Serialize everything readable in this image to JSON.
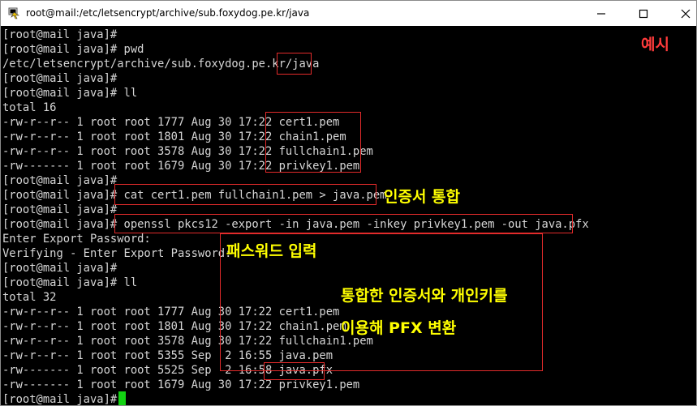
{
  "window": {
    "title": "root@mail:/etc/letsencrypt/archive/sub.foxydog.pe.kr/java",
    "icons": {
      "app": "putty-icon",
      "minimize": "minimize-icon",
      "maximize": "maximize-icon",
      "close": "close-icon"
    }
  },
  "terminal": {
    "lines": [
      "[root@mail java]#",
      "[root@mail java]# pwd",
      "/etc/letsencrypt/archive/sub.foxydog.pe.kr/java",
      "[root@mail java]#",
      "[root@mail java]# ll",
      "total 16",
      "-rw-r--r-- 1 root root 1777 Aug 30 17:22 cert1.pem",
      "-rw-r--r-- 1 root root 1801 Aug 30 17:22 chain1.pem",
      "-rw-r--r-- 1 root root 3578 Aug 30 17:22 fullchain1.pem",
      "-rw------- 1 root root 1679 Aug 30 17:22 privkey1.pem",
      "[root@mail java]#",
      "[root@mail java]# cat cert1.pem fullchain1.pem > java.pem",
      "[root@mail java]#",
      "[root@mail java]# openssl pkcs12 -export -in java.pem -inkey privkey1.pem -out java.pfx",
      "Enter Export Password:",
      "Verifying - Enter Export Password:",
      "[root@mail java]#",
      "[root@mail java]# ll",
      "total 32",
      "-rw-r--r-- 1 root root 1777 Aug 30 17:22 cert1.pem",
      "-rw-r--r-- 1 root root 1801 Aug 30 17:22 chain1.pem",
      "-rw-r--r-- 1 root root 3578 Aug 30 17:22 fullchain1.pem",
      "-rw-r--r-- 1 root root 5355 Sep  2 16:55 java.pem",
      "-rw------- 1 root root 5525 Sep  2 16:58 java.pfx",
      "-rw------- 1 root root 1679 Aug 30 17:22 privkey1.pem",
      "[root@mail java]#"
    ]
  },
  "annotations": {
    "example": "예시",
    "merge_certificates": "인증서 통합",
    "password_input": "패스워드 입력",
    "convert_line1": "통합한 인증서와 개인키를",
    "convert_line2": "이용해 PFX 변환",
    "colors": {
      "highlight_box": "#e32b2b",
      "note_text": "#ffff00",
      "example_text": "#ff3b3b",
      "cursor": "#13d313"
    }
  }
}
